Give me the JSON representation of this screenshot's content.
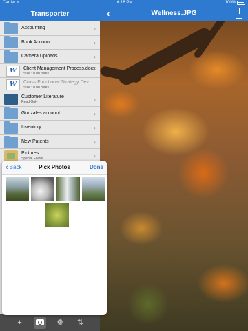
{
  "status_bar": {
    "carrier": "Carrier",
    "time": "6:16 PM",
    "battery": "100%"
  },
  "left_pane": {
    "title": "Transporter",
    "items": [
      {
        "label": "Accounting",
        "icon": "folder-icon"
      },
      {
        "label": "Book Account",
        "icon": "folder-icon"
      },
      {
        "label": "Camera Uploads",
        "icon": "folder-icon"
      },
      {
        "label": "Client Management Process.docx",
        "sub": "Size : 0.00 bytes",
        "icon": "word-doc-icon"
      },
      {
        "label": "Cross Functional Strategy Dev...",
        "sub": "Size : 0.00 bytes",
        "icon": "word-doc-icon"
      },
      {
        "label": "Customer Literature",
        "sub": "Read Only",
        "icon": "book-icon"
      },
      {
        "label": "Gonzales account",
        "icon": "folder-icon"
      },
      {
        "label": "Inventory",
        "icon": "folder-icon"
      },
      {
        "label": "New Patents",
        "icon": "folder-icon"
      },
      {
        "label": "Pictures",
        "sub": "Special Folder",
        "icon": "pictures-folder-icon"
      }
    ],
    "doc_glyph": "W",
    "chevron": "›"
  },
  "toolbar": {
    "add": "+",
    "settings": "⚙",
    "transfer": "⇅"
  },
  "right_pane": {
    "title": "Wellness.JPG",
    "back": "‹"
  },
  "popover": {
    "back_label": "Back",
    "back_chevron": "‹",
    "title": "Pick Photos",
    "done_label": "Done",
    "photos": [
      "photo-1",
      "photo-2",
      "photo-3",
      "photo-4",
      "photo-5"
    ]
  },
  "colors": {
    "accent": "#2e7ad0",
    "list_bg": "#e8e8e8",
    "toolbar_bg": "#4a4a4a"
  }
}
